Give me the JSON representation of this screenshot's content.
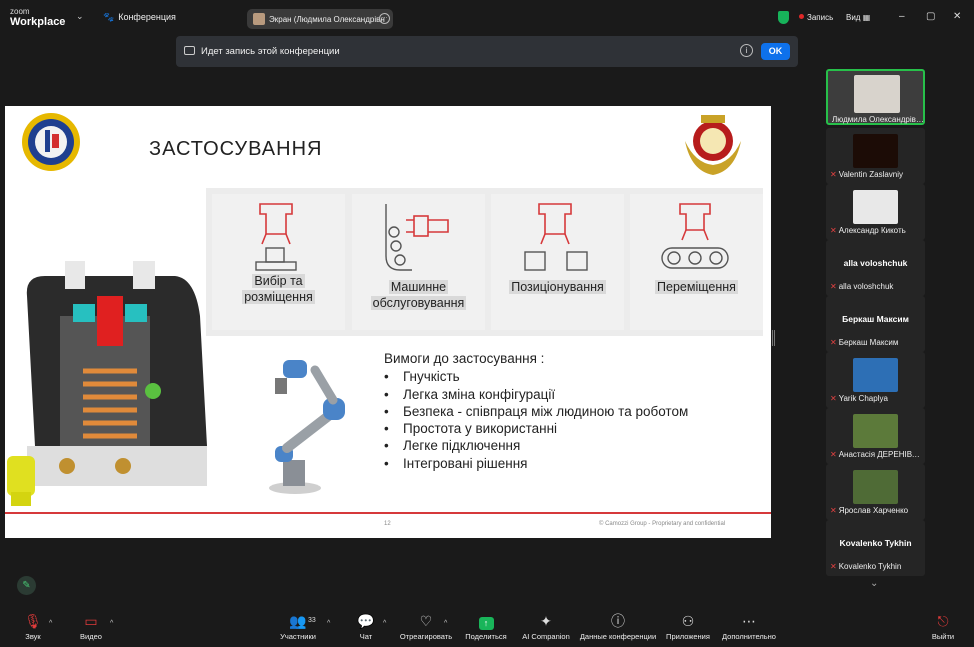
{
  "app": {
    "logo_top": "zoom",
    "logo_bottom": "Workplace",
    "conference_label": "Конференция"
  },
  "screen_share": {
    "label": "Экран (Людмила Олександрівн"
  },
  "status": {
    "record_label": "Запись",
    "view_label": "Вид"
  },
  "window": {
    "minimize": "–",
    "maximize": "▢",
    "close": "✕"
  },
  "banner": {
    "text": "Идет запись этой конференции",
    "ok_label": "OK"
  },
  "slide": {
    "title": "ЗАСТОСУВАННЯ",
    "cells": [
      {
        "label_line1": "Вибір   та",
        "label_line2": "розміщення"
      },
      {
        "label_line1": "Машинне",
        "label_line2": "обслуговування"
      },
      {
        "label_line1": "Позиціонування",
        "label_line2": ""
      },
      {
        "label_line1": "Переміщення",
        "label_line2": ""
      }
    ],
    "requirements_title": "Вимоги до застосування :",
    "requirements": [
      "Гнучкість",
      "Легка зміна конфігурації",
      "Безпека - співпраця між людиною та роботом",
      "Простота у використанні",
      "Легке підключення",
      "Інтегровані рішення"
    ],
    "page_number": "12",
    "footer": "© Camozzi Group - Proprietary and confidential",
    "accent_color": "#d6393b"
  },
  "participants": [
    {
      "name": "Людмила Олександрівн...",
      "active": true
    },
    {
      "name": "Valentin Zaslavniy"
    },
    {
      "name": "Александр Кикоть"
    },
    {
      "big": "alla voloshchuk",
      "name": "alla voloshchuk"
    },
    {
      "big": "Беркаш Максим",
      "name": "Беркаш Максим"
    },
    {
      "name": "Yarik Chaplya"
    },
    {
      "name": "Анастасія ДЕРЕНІВСЬ..."
    },
    {
      "name": "Ярослав Харченко"
    },
    {
      "big": "Kovalenko Tykhin",
      "name": "Kovalenko Tykhin"
    }
  ],
  "toolbar": {
    "audio": "Звук",
    "video": "Видео",
    "participants": "Участники",
    "participants_count": "33",
    "chat": "Чат",
    "react": "Отреагировать",
    "share": "Поделиться",
    "ai": "AI Companion",
    "info": "Данные конференции",
    "apps": "Приложения",
    "more": "Дополнительно",
    "leave": "Выйти"
  },
  "icons": [
    "paw-icon",
    "shield-icon",
    "camera-icon",
    "info-icon",
    "mic-muted-icon",
    "video-off-icon",
    "people-icon",
    "chat-icon",
    "heart-icon",
    "share-up-icon",
    "sparkle-icon",
    "info-circle-icon",
    "apps-icon",
    "more-dots-icon",
    "exit-icon",
    "pencil-icon"
  ]
}
